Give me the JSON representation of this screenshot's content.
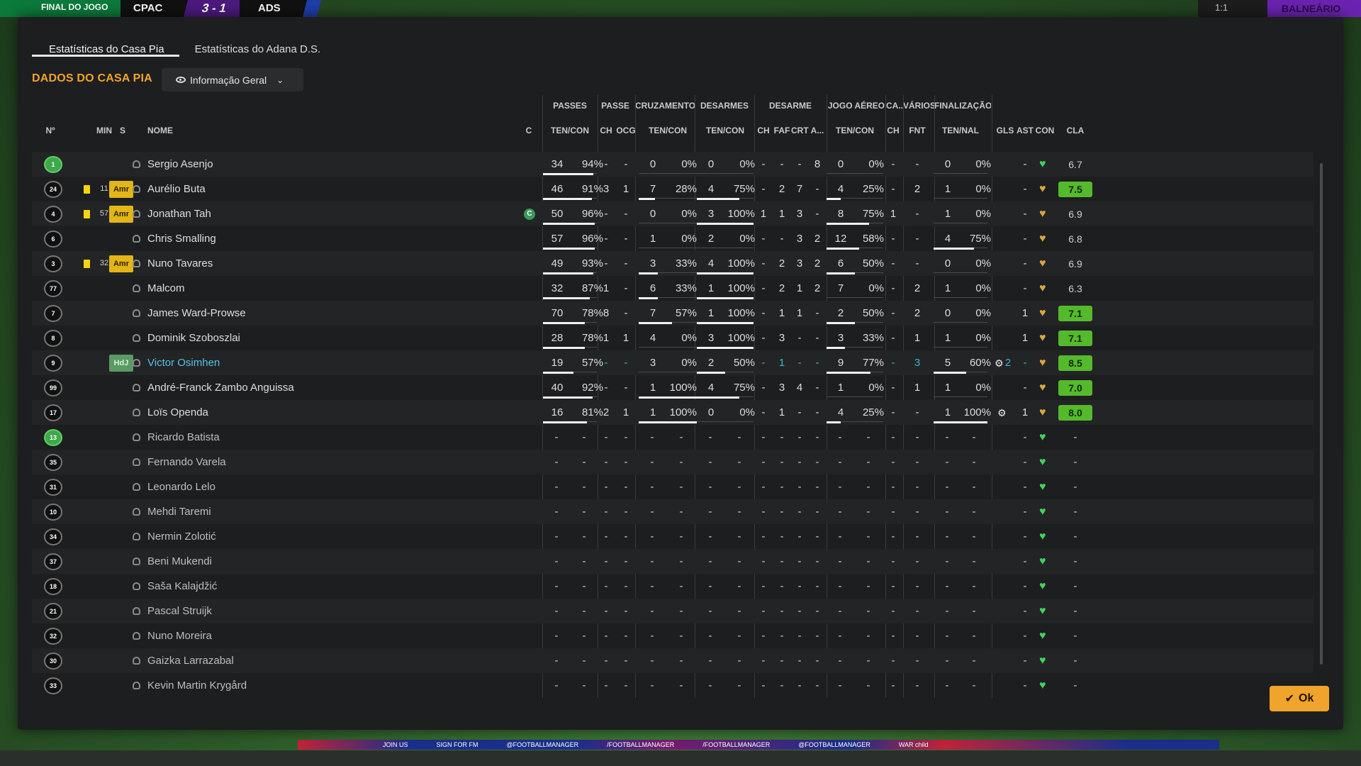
{
  "topbar": {
    "final_label": "FINAL DO JOGO",
    "home_abbr": "CPAC",
    "score": "3 - 1",
    "away_abbr": "ADS",
    "right_text": "1:1",
    "balneario": "BALNEÁRIO",
    "adboard": [
      "JOIN US",
      "SIGN FOR FM",
      "@FOOTBALLMANAGER",
      "/FOOTBALLMANAGER",
      "/FOOTBALLMANAGER",
      "@FOOTBALLMANAGER",
      "WAR child"
    ]
  },
  "tabs": [
    {
      "label": "Estatísticas do Casa Pia",
      "active": true
    },
    {
      "label": "Estatísticas do Adana D.S.",
      "active": false
    }
  ],
  "section_title": "DADOS DO CASA PIA",
  "dropdown": {
    "label": "Informação Geral",
    "icon": "eye-icon"
  },
  "group_headers": [
    "PASSES",
    "PASSE",
    "CRUZAMENTOS",
    "DESARMES",
    "DESARME",
    "JOGO AÉREO",
    "CA...",
    "VÁRIOS",
    "FINALIZAÇÃO"
  ],
  "column_headers": {
    "num": "Nº",
    "min": "MIN",
    "s": "S",
    "name": "NOME",
    "c": "C",
    "passes": "TEN/CON",
    "passe_ch": "CH",
    "passe_ocg": "OCG",
    "cruz": "TEN/CON",
    "desarmes": "TEN/CON",
    "des_ch": "CH",
    "des_faf": "FAF",
    "des_crt": "CRT",
    "des_a": "A...",
    "aereo": "TEN/CON",
    "ca_ch": "CH",
    "varios_fnt": "FNT",
    "final": "TEN/NAL",
    "gls": "GLS",
    "ast": "AST",
    "con": "CON",
    "cla": "CLA"
  },
  "players": [
    {
      "num": "1",
      "gk": true,
      "card": false,
      "min": "",
      "pos": "",
      "name": "Sergio Asenjo",
      "captain": false,
      "link": false,
      "p_ten": "34",
      "p_pct": "94%",
      "p_fill": 0.94,
      "ch": "-",
      "ocg": "-",
      "c_ten": "0",
      "c_pct": "0%",
      "c_fill": 0,
      "d_ten": "0",
      "d_pct": "0%",
      "d_fill": 0,
      "d_ch": "-",
      "faf": "-",
      "crt": "-",
      "da": "8",
      "a_ten": "0",
      "a_pct": "0%",
      "a_fill": 0,
      "ca": "-",
      "fnt": "-",
      "f_ten": "0",
      "f_pct": "0%",
      "f_fill": 0,
      "gls": "",
      "ast": "-",
      "con": "green",
      "cla": "6.7",
      "cla_hi": false,
      "gear": false,
      "teal": false
    },
    {
      "num": "24",
      "gk": false,
      "card": true,
      "min": "11",
      "pos": "Amr",
      "name": "Aurélio Buta",
      "captain": false,
      "link": false,
      "p_ten": "46",
      "p_pct": "91%",
      "p_fill": 0.91,
      "ch": "3",
      "ocg": "1",
      "c_ten": "7",
      "c_pct": "28%",
      "c_fill": 0.28,
      "d_ten": "4",
      "d_pct": "75%",
      "d_fill": 0.75,
      "d_ch": "-",
      "faf": "2",
      "crt": "7",
      "da": "-",
      "a_ten": "4",
      "a_pct": "25%",
      "a_fill": 0.25,
      "ca": "-",
      "fnt": "2",
      "f_ten": "1",
      "f_pct": "0%",
      "f_fill": 0,
      "gls": "",
      "ast": "-",
      "con": "gold",
      "cla": "7.5",
      "cla_hi": true,
      "gear": false,
      "teal": false
    },
    {
      "num": "4",
      "gk": false,
      "card": true,
      "min": "57",
      "pos": "Amr",
      "name": "Jonathan Tah",
      "captain": true,
      "link": false,
      "p_ten": "50",
      "p_pct": "96%",
      "p_fill": 0.96,
      "ch": "-",
      "ocg": "-",
      "c_ten": "0",
      "c_pct": "0%",
      "c_fill": 0,
      "d_ten": "3",
      "d_pct": "100%",
      "d_fill": 1,
      "d_ch": "1",
      "faf": "1",
      "crt": "3",
      "da": "-",
      "a_ten": "8",
      "a_pct": "75%",
      "a_fill": 0.75,
      "ca": "1",
      "fnt": "-",
      "f_ten": "1",
      "f_pct": "0%",
      "f_fill": 0,
      "gls": "",
      "ast": "-",
      "con": "gold",
      "cla": "6.9",
      "cla_hi": false,
      "gear": false,
      "teal": false
    },
    {
      "num": "6",
      "gk": false,
      "card": false,
      "min": "",
      "pos": "",
      "name": "Chris Smalling",
      "captain": false,
      "link": false,
      "p_ten": "57",
      "p_pct": "96%",
      "p_fill": 0.96,
      "ch": "-",
      "ocg": "-",
      "c_ten": "1",
      "c_pct": "0%",
      "c_fill": 0,
      "d_ten": "2",
      "d_pct": "0%",
      "d_fill": 0,
      "d_ch": "-",
      "faf": "-",
      "crt": "3",
      "da": "2",
      "a_ten": "12",
      "a_pct": "58%",
      "a_fill": 0.58,
      "ca": "-",
      "fnt": "-",
      "f_ten": "4",
      "f_pct": "75%",
      "f_fill": 0.75,
      "gls": "",
      "ast": "-",
      "con": "gold",
      "cla": "6.8",
      "cla_hi": false,
      "gear": false,
      "teal": false
    },
    {
      "num": "3",
      "gk": false,
      "card": true,
      "min": "32",
      "pos": "Amr",
      "name": "Nuno Tavares",
      "captain": false,
      "link": false,
      "p_ten": "49",
      "p_pct": "93%",
      "p_fill": 0.93,
      "ch": "-",
      "ocg": "-",
      "c_ten": "3",
      "c_pct": "33%",
      "c_fill": 0.33,
      "d_ten": "4",
      "d_pct": "100%",
      "d_fill": 1,
      "d_ch": "-",
      "faf": "2",
      "crt": "3",
      "da": "2",
      "a_ten": "6",
      "a_pct": "50%",
      "a_fill": 0.5,
      "ca": "-",
      "fnt": "-",
      "f_ten": "0",
      "f_pct": "0%",
      "f_fill": 0,
      "gls": "",
      "ast": "-",
      "con": "gold",
      "cla": "6.9",
      "cla_hi": false,
      "gear": false,
      "teal": false
    },
    {
      "num": "77",
      "gk": false,
      "card": false,
      "min": "",
      "pos": "",
      "name": "Malcom",
      "captain": false,
      "link": false,
      "p_ten": "32",
      "p_pct": "87%",
      "p_fill": 0.87,
      "ch": "1",
      "ocg": "-",
      "c_ten": "6",
      "c_pct": "33%",
      "c_fill": 0.33,
      "d_ten": "1",
      "d_pct": "100%",
      "d_fill": 1,
      "d_ch": "-",
      "faf": "2",
      "crt": "1",
      "da": "2",
      "a_ten": "7",
      "a_pct": "0%",
      "a_fill": 0,
      "ca": "-",
      "fnt": "2",
      "f_ten": "1",
      "f_pct": "0%",
      "f_fill": 0,
      "gls": "",
      "ast": "-",
      "con": "gold",
      "cla": "6.3",
      "cla_hi": false,
      "gear": false,
      "teal": false
    },
    {
      "num": "7",
      "gk": false,
      "card": false,
      "min": "",
      "pos": "",
      "name": "James Ward-Prowse",
      "captain": false,
      "link": false,
      "p_ten": "70",
      "p_pct": "78%",
      "p_fill": 0.78,
      "ch": "8",
      "ocg": "-",
      "c_ten": "7",
      "c_pct": "57%",
      "c_fill": 0.57,
      "d_ten": "1",
      "d_pct": "100%",
      "d_fill": 1,
      "d_ch": "-",
      "faf": "1",
      "crt": "1",
      "da": "-",
      "a_ten": "2",
      "a_pct": "50%",
      "a_fill": 0.5,
      "ca": "-",
      "fnt": "2",
      "f_ten": "0",
      "f_pct": "0%",
      "f_fill": 0,
      "gls": "",
      "ast": "1",
      "con": "gold",
      "cla": "7.1",
      "cla_hi": true,
      "gear": false,
      "teal": false
    },
    {
      "num": "8",
      "gk": false,
      "card": false,
      "min": "",
      "pos": "",
      "name": "Dominik Szoboszlai",
      "captain": false,
      "link": false,
      "p_ten": "28",
      "p_pct": "78%",
      "p_fill": 0.78,
      "ch": "1",
      "ocg": "1",
      "c_ten": "4",
      "c_pct": "0%",
      "c_fill": 0,
      "d_ten": "3",
      "d_pct": "100%",
      "d_fill": 1,
      "d_ch": "-",
      "faf": "3",
      "crt": "-",
      "da": "-",
      "a_ten": "3",
      "a_pct": "33%",
      "a_fill": 0.33,
      "ca": "-",
      "fnt": "1",
      "f_ten": "1",
      "f_pct": "0%",
      "f_fill": 0,
      "gls": "",
      "ast": "1",
      "con": "gold",
      "cla": "7.1",
      "cla_hi": true,
      "gear": false,
      "teal": false
    },
    {
      "num": "9",
      "gk": false,
      "card": false,
      "min": "",
      "pos": "HdJ",
      "name": "Victor Osimhen",
      "captain": false,
      "link": true,
      "p_ten": "19",
      "p_pct": "57%",
      "p_fill": 0.57,
      "ch": "-",
      "ocg": "-",
      "c_ten": "3",
      "c_pct": "0%",
      "c_fill": 0,
      "d_ten": "2",
      "d_pct": "50%",
      "d_fill": 0.5,
      "d_ch": "-",
      "faf": "1",
      "crt": "-",
      "da": "-",
      "a_ten": "9",
      "a_pct": "77%",
      "a_fill": 0.77,
      "ca": "-",
      "fnt": "3",
      "f_ten": "5",
      "f_pct": "60%",
      "f_fill": 0.6,
      "gls": "2",
      "ast": "-",
      "con": "gold",
      "cla": "8.5",
      "cla_hi": true,
      "gear": true,
      "teal": true
    },
    {
      "num": "99",
      "gk": false,
      "card": false,
      "min": "",
      "pos": "",
      "name": "André-Franck Zambo Anguissa",
      "captain": false,
      "link": false,
      "p_ten": "40",
      "p_pct": "92%",
      "p_fill": 0.92,
      "ch": "-",
      "ocg": "-",
      "c_ten": "1",
      "c_pct": "100%",
      "c_fill": 1,
      "d_ten": "4",
      "d_pct": "75%",
      "d_fill": 0.75,
      "d_ch": "-",
      "faf": "3",
      "crt": "4",
      "da": "-",
      "a_ten": "1",
      "a_pct": "0%",
      "a_fill": 0,
      "ca": "-",
      "fnt": "1",
      "f_ten": "1",
      "f_pct": "0%",
      "f_fill": 0,
      "gls": "",
      "ast": "-",
      "con": "gold",
      "cla": "7.0",
      "cla_hi": true,
      "gear": false,
      "teal": false
    },
    {
      "num": "17",
      "gk": false,
      "card": false,
      "min": "",
      "pos": "",
      "name": "Loïs Openda",
      "captain": false,
      "link": false,
      "p_ten": "16",
      "p_pct": "81%",
      "p_fill": 0.81,
      "ch": "2",
      "ocg": "1",
      "c_ten": "1",
      "c_pct": "100%",
      "c_fill": 1,
      "d_ten": "0",
      "d_pct": "0%",
      "d_fill": 0,
      "d_ch": "-",
      "faf": "1",
      "crt": "-",
      "da": "-",
      "a_ten": "4",
      "a_pct": "25%",
      "a_fill": 0.25,
      "ca": "-",
      "fnt": "-",
      "f_ten": "1",
      "f_pct": "100%",
      "f_fill": 1,
      "gls": "",
      "ast": "1",
      "con": "gold",
      "cla": "8.0",
      "cla_hi": true,
      "gear": true,
      "teal": false
    },
    {
      "num": "13",
      "gk": true,
      "sub": true,
      "name": "Ricardo Batista"
    },
    {
      "num": "35",
      "gk": false,
      "sub": true,
      "name": "Fernando Varela"
    },
    {
      "num": "31",
      "gk": false,
      "sub": true,
      "name": "Leonardo Lelo"
    },
    {
      "num": "10",
      "gk": false,
      "sub": true,
      "name": "Mehdi Taremi"
    },
    {
      "num": "34",
      "gk": false,
      "sub": true,
      "name": "Nermin Zolotić"
    },
    {
      "num": "37",
      "gk": false,
      "sub": true,
      "name": "Beni Mukendi"
    },
    {
      "num": "18",
      "gk": false,
      "sub": true,
      "name": "Saša Kalajdžić"
    },
    {
      "num": "21",
      "gk": false,
      "sub": true,
      "name": "Pascal Struijk"
    },
    {
      "num": "32",
      "gk": false,
      "sub": true,
      "name": "Nuno Moreira"
    },
    {
      "num": "30",
      "gk": false,
      "sub": true,
      "name": "Gaizka Larrazabal"
    },
    {
      "num": "33",
      "gk": false,
      "sub": true,
      "name": "Kevin Martin Krygård"
    }
  ],
  "dash": "-",
  "ok_button": "Ok",
  "colors": {
    "accent": "#f0a42b",
    "rating_green": "#55b92c",
    "heart_green": "#3fd45a",
    "heart_gold": "#d9a83c",
    "link": "#56c2e6"
  }
}
